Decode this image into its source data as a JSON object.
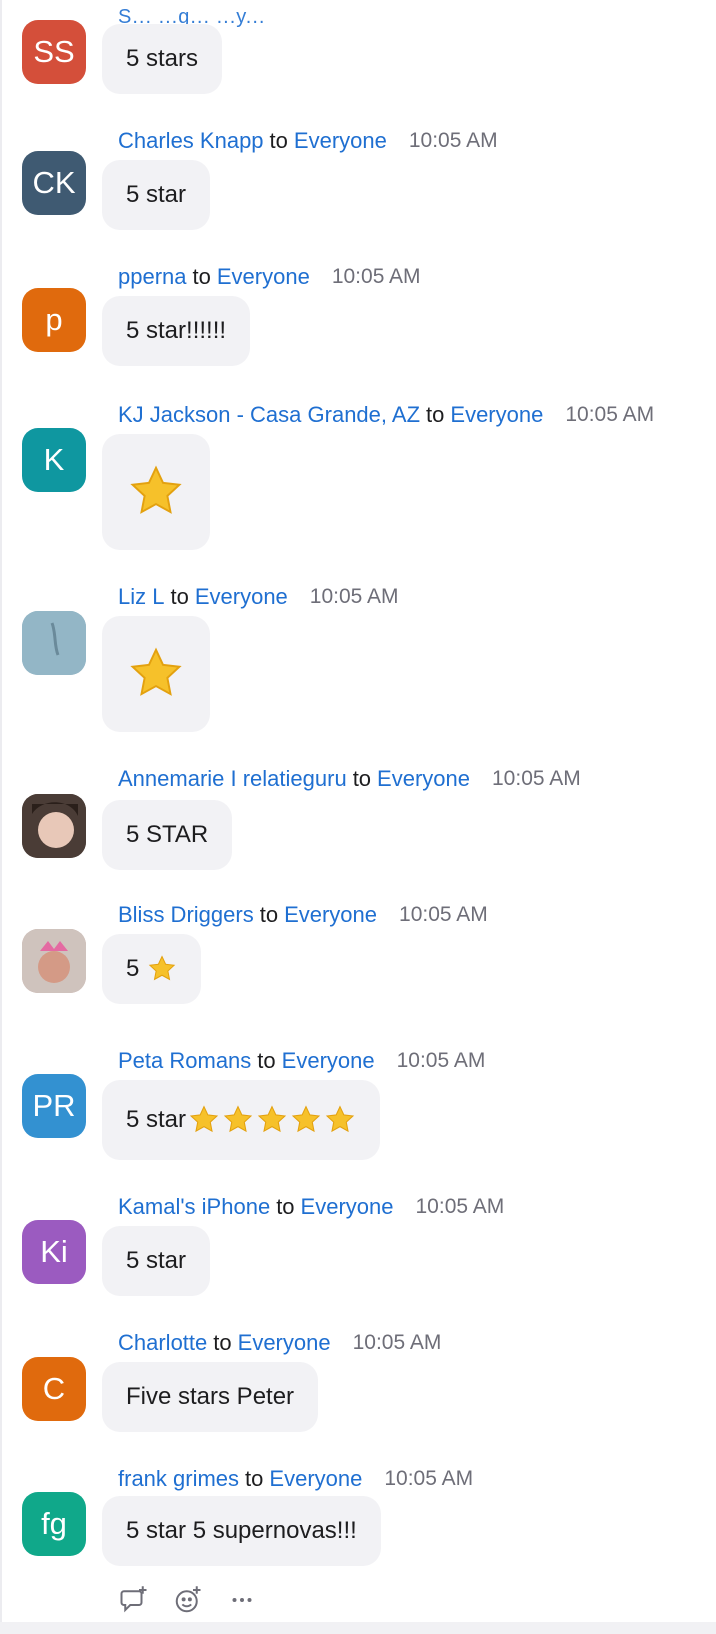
{
  "top_partial_text": "S... ...g... ...y...",
  "messages": [
    {
      "initials": "SS",
      "avatar_color": "#d44f3a",
      "sender": "",
      "to": "",
      "target": "",
      "time": "",
      "text": "5 stars"
    },
    {
      "initials": "CK",
      "avatar_color": "#3f5a72",
      "sender": "Charles Knapp",
      "to": "to",
      "target": "Everyone",
      "time": "10:05 AM",
      "text": "5 star"
    },
    {
      "initials": "p",
      "avatar_color": "#e06a0d",
      "sender": "pperna",
      "to": "to",
      "target": "Everyone",
      "time": "10:05 AM",
      "text": "5 star!!!!!!"
    },
    {
      "initials": "K",
      "avatar_color": "#0f97a0",
      "sender": "KJ Jackson - Casa Grande, AZ",
      "to": "to",
      "target": "Everyone",
      "time": "10:05 AM",
      "text": ""
    },
    {
      "initials": "",
      "avatar_color": "#8fb1c2",
      "sender": "Liz L",
      "to": "to",
      "target": "Everyone",
      "time": "10:05 AM",
      "text": ""
    },
    {
      "initials": "",
      "avatar_color": "#5a4a42",
      "sender": "Annemarie I relatieguru",
      "to": "to",
      "target": "Everyone",
      "time": "10:05 AM",
      "text": "5 STAR"
    },
    {
      "initials": "",
      "avatar_color": "#c7a7a0",
      "sender": "Bliss Driggers",
      "to": "to",
      "target": "Everyone",
      "time": "10:05 AM",
      "text": "5"
    },
    {
      "initials": "PR",
      "avatar_color": "#3391d1",
      "sender": "Peta Romans",
      "to": "to",
      "target": "Everyone",
      "time": "10:05 AM",
      "text": "5 star"
    },
    {
      "initials": "Ki",
      "avatar_color": "#9b5bc0",
      "sender": "Kamal's iPhone",
      "to": "to",
      "target": "Everyone",
      "time": "10:05 AM",
      "text": "5 star"
    },
    {
      "initials": "C",
      "avatar_color": "#e06a0d",
      "sender": "Charlotte",
      "to": "to",
      "target": "Everyone",
      "time": "10:05 AM",
      "text": "Five stars Peter"
    },
    {
      "initials": "fg",
      "avatar_color": "#10a88a",
      "sender": "frank grimes",
      "to": "to",
      "target": "Everyone",
      "time": "10:05 AM",
      "text": "5 star 5 supernovas!!!"
    }
  ],
  "icons": {
    "reply": "reply-thread-icon",
    "emoji": "add-reaction-icon",
    "more": "more-options-icon"
  }
}
